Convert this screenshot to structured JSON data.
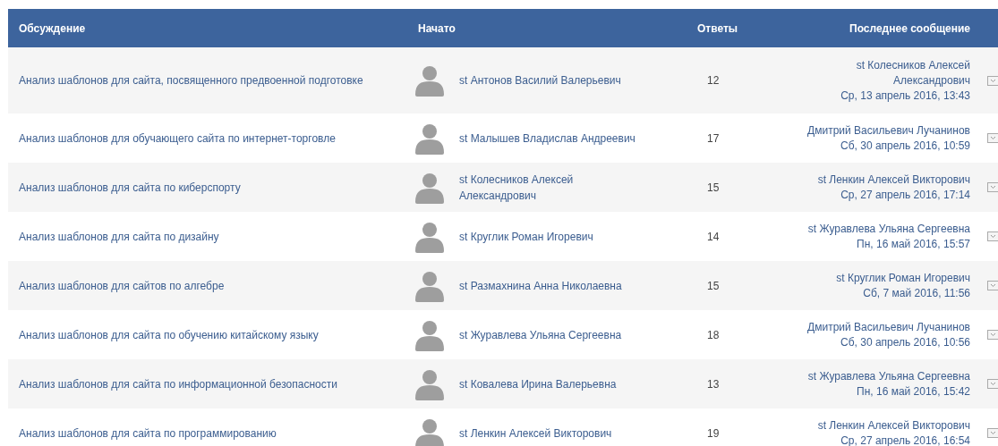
{
  "table": {
    "columns": [
      "Обсуждение",
      "Начато",
      "Ответы",
      "Последнее сообщение"
    ],
    "rows": [
      {
        "topic": "Анализ шаблонов для сайта, посвященного предвоенной подготовке",
        "started_by": "st Антонов Василий Валерьевич",
        "replies": "12",
        "last_author": "st Колесников Алексей Александрович",
        "last_date": "Ср, 13 апрель 2016, 13:43"
      },
      {
        "topic": "Анализ шаблонов для обучающего сайта по интернет-торговле",
        "started_by": "st Малышев Владислав Андреевич",
        "replies": "17",
        "last_author": "Дмитрий Васильевич Лучанинов",
        "last_date": "Сб, 30 апрель 2016, 10:59"
      },
      {
        "topic": "Анализ шаблонов для сайта по киберспорту",
        "started_by": "st Колесников Алексей Александрович",
        "replies": "15",
        "last_author": "st Ленкин Алексей Викторович",
        "last_date": "Ср, 27 апрель 2016, 17:14"
      },
      {
        "topic": "Анализ шаблонов для сайта по дизайну",
        "started_by": "st Круглик Роман Игоревич",
        "replies": "14",
        "last_author": "st Журавлева Ульяна Сергеевна",
        "last_date": "Пн, 16 май 2016, 15:57"
      },
      {
        "topic": "Анализ шаблонов для сайтов по алгебре",
        "started_by": "st Размахнина Анна Николаевна",
        "replies": "15",
        "last_author": "st Круглик Роман Игоревич",
        "last_date": "Сб, 7 май 2016, 11:56"
      },
      {
        "topic": "Анализ шаблонов для сайта по обучению китайскому языку",
        "started_by": "st Журавлева Ульяна Сергеевна",
        "replies": "18",
        "last_author": "Дмитрий Васильевич Лучанинов",
        "last_date": "Сб, 30 апрель 2016, 10:56"
      },
      {
        "topic": "Анализ шаблонов для сайта по информационной безопасности",
        "started_by": "st Ковалева Ирина Валерьевна",
        "replies": "13",
        "last_author": "st Журавлева Ульяна Сергеевна",
        "last_date": "Пн, 16 май 2016, 15:42"
      },
      {
        "topic": "Анализ шаблонов для сайта по программированию",
        "started_by": "st Ленкин Алексей Викторович",
        "replies": "19",
        "last_author": "st Ленкин Алексей Викторович",
        "last_date": "Ср, 27 апрель 2016, 16:54"
      }
    ]
  }
}
